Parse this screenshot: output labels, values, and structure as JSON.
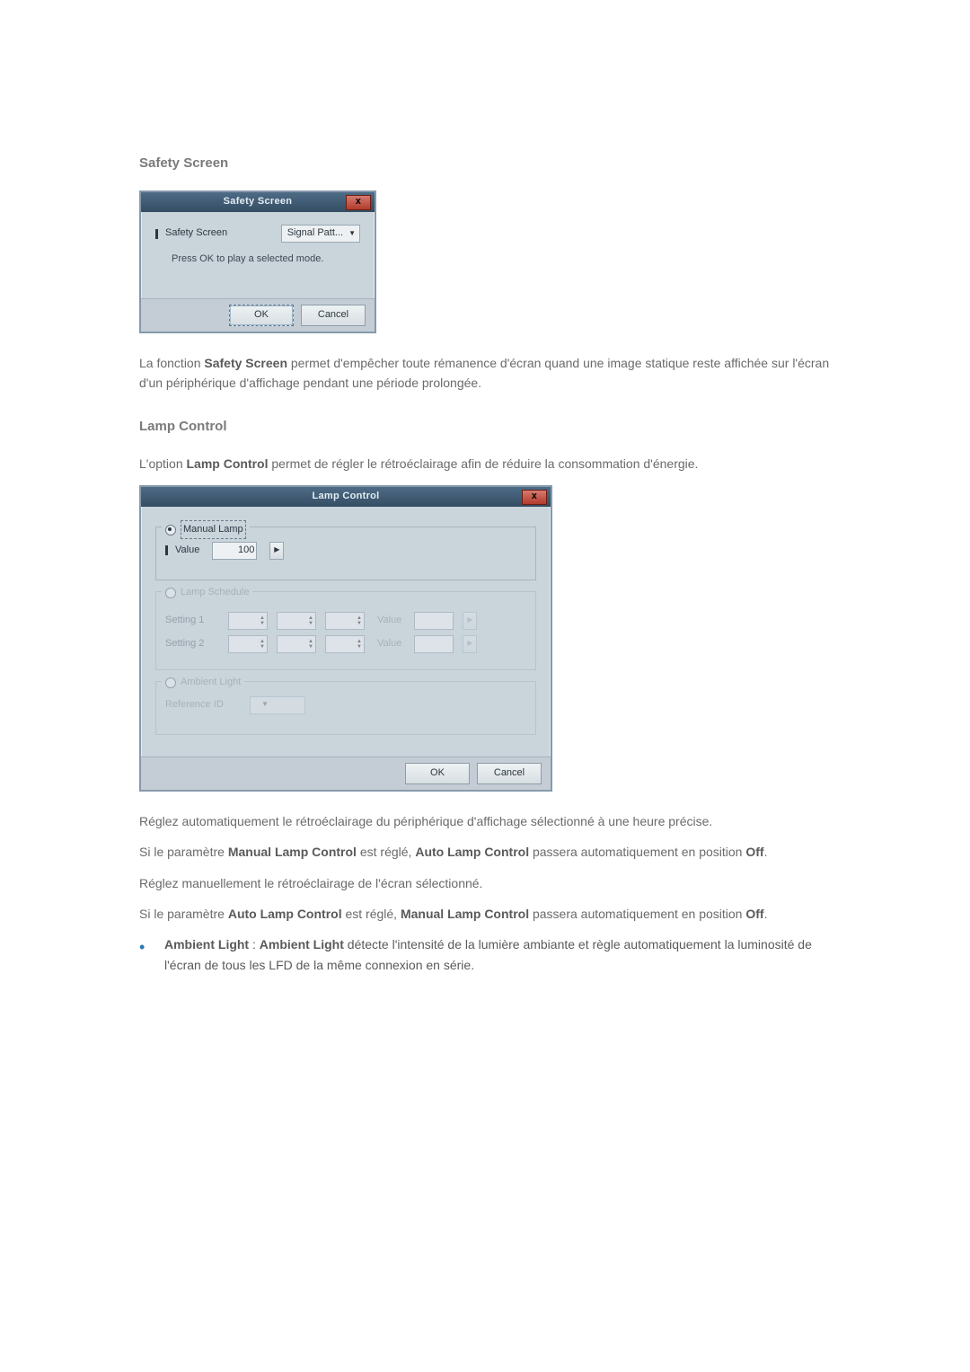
{
  "headings": {
    "safety_screen": "Safety Screen",
    "lamp_control": "Lamp Control"
  },
  "safety_dialog": {
    "title": "Safety Screen",
    "close": "x",
    "field_label": "Safety Screen",
    "dropdown_value": "Signal Patt...",
    "hint": "Press OK to play a selected mode.",
    "ok": "OK",
    "cancel": "Cancel"
  },
  "safety_para": {
    "p1a": "La fonction ",
    "p1b": "Safety Screen",
    "p1c": " permet d'empêcher toute rémanence d'écran quand une image statique reste affichée sur l'écran d'un périphérique d'affichage pendant une période prolongée."
  },
  "lamp_intro": {
    "a": "L'option ",
    "b": "Lamp Control",
    "c": " permet de régler le rétroéclairage afin de réduire la consommation d'énergie."
  },
  "lamp_dialog": {
    "title": "Lamp Control",
    "close": "x",
    "manual_legend": "Manual Lamp",
    "value_label": "Value",
    "value": "100",
    "schedule_legend": "Lamp Schedule",
    "setting1": "Setting 1",
    "setting2": "Setting 2",
    "val_label": "Value",
    "ambient_legend": "Ambient Light",
    "reference_label": "Reference ID",
    "ok": "OK",
    "cancel": "Cancel"
  },
  "paras": {
    "p2": "Réglez automatiquement le rétroéclairage du périphérique d'affichage sélectionné à une heure précise.",
    "p3a": "Si le paramètre ",
    "p3b": "Manual Lamp Control",
    "p3c": " est réglé, ",
    "p3d": "Auto Lamp Control",
    "p3e": " passera automatiquement en position ",
    "p3f": "Off",
    "p3g": ".",
    "p4": "Réglez manuellement le rétroéclairage de l'écran sélectionné.",
    "p5a": "Si le paramètre ",
    "p5b": "Auto Lamp Control",
    "p5c": " est réglé, ",
    "p5d": "Manual Lamp Control",
    "p5e": " passera automatiquement en position ",
    "p5f": "Off",
    "p5g": ".",
    "bullet_a": "Ambient Light",
    "bullet_sep": " : ",
    "bullet_b": "Ambient Light",
    "bullet_c": " détecte l'intensité de la lumière ambiante et règle automatiquement la luminosité de l'écran de tous les LFD de la même connexion en série."
  }
}
